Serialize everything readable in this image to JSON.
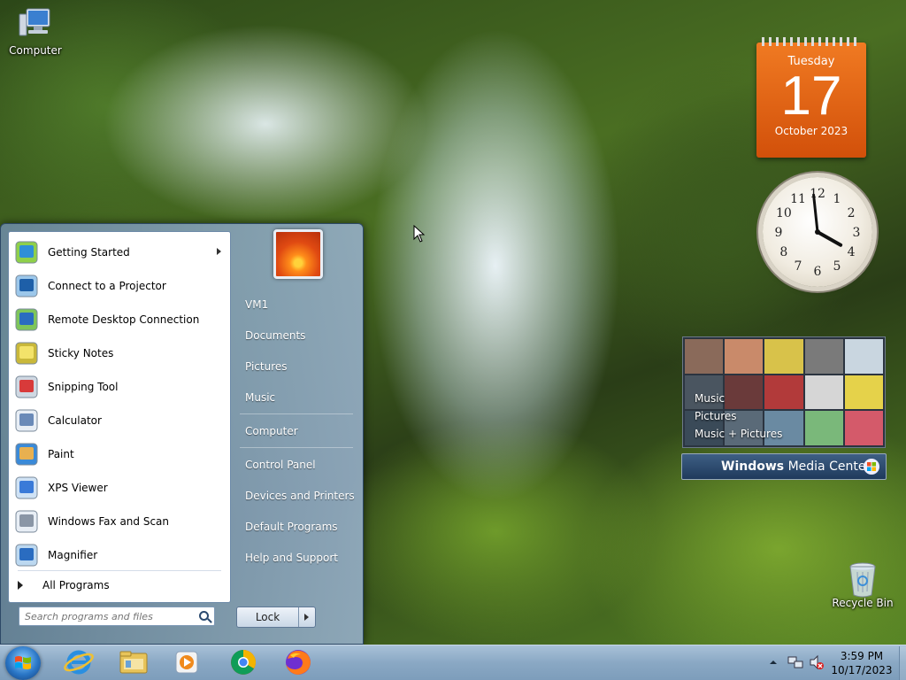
{
  "desktop": {
    "computer_label": "Computer",
    "recycle_label": "Recycle Bin"
  },
  "calendar": {
    "day_of_week": "Tuesday",
    "day": "17",
    "month_year": "October 2023"
  },
  "clock_gadget": {
    "numerals": [
      "12",
      "1",
      "2",
      "3",
      "4",
      "5",
      "6",
      "7",
      "8",
      "9",
      "10",
      "11"
    ],
    "hour": 3,
    "minute": 59
  },
  "media_center": {
    "items": [
      "Music",
      "Pictures",
      "Music + Pictures"
    ],
    "brand_bold": "Windows",
    "brand_rest": " Media Center"
  },
  "start_menu": {
    "programs": [
      {
        "label": "Getting Started",
        "icon": "getting-started-icon",
        "submenu": true
      },
      {
        "label": "Connect to a Projector",
        "icon": "projector-icon"
      },
      {
        "label": "Remote Desktop Connection",
        "icon": "remote-desktop-icon"
      },
      {
        "label": "Sticky Notes",
        "icon": "sticky-notes-icon"
      },
      {
        "label": "Snipping Tool",
        "icon": "snipping-tool-icon"
      },
      {
        "label": "Calculator",
        "icon": "calculator-icon"
      },
      {
        "label": "Paint",
        "icon": "paint-icon"
      },
      {
        "label": "XPS Viewer",
        "icon": "xps-viewer-icon"
      },
      {
        "label": "Windows Fax and Scan",
        "icon": "fax-scan-icon"
      },
      {
        "label": "Magnifier",
        "icon": "magnifier-icon"
      }
    ],
    "all_programs": "All Programs",
    "search_placeholder": "Search programs and files",
    "places": [
      "VM1",
      "Documents",
      "Pictures",
      "Music",
      "Computer",
      "Control Panel",
      "Devices and Printers",
      "Default Programs",
      "Help and Support"
    ],
    "lock_label": "Lock"
  },
  "taskbar": {
    "time": "3:59 PM",
    "date": "10/17/2023",
    "pinned": [
      "internet-explorer-icon",
      "file-explorer-icon",
      "media-player-icon",
      "chrome-icon",
      "firefox-icon"
    ]
  }
}
